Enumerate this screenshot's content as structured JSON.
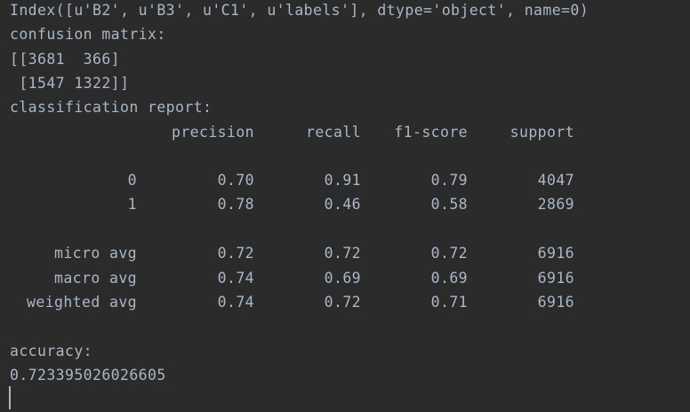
{
  "console": {
    "index_line": "Index([u'B2', u'B3', u'C1', u'labels'], dtype='object', name=0)",
    "confusion_label": "confusion matrix:",
    "matrix_row_1": "[[3681  366]",
    "matrix_row_2": " [1547 1322]]",
    "report_label": "classification report:",
    "report": {
      "headers": [
        "precision",
        "recall",
        "f1-score",
        "support"
      ],
      "rows": [
        {
          "label": "0",
          "precision": "0.70",
          "recall": "0.91",
          "f1": "0.79",
          "support": "4047"
        },
        {
          "label": "1",
          "precision": "0.78",
          "recall": "0.46",
          "f1": "0.58",
          "support": "2869"
        },
        {
          "label": "micro avg",
          "precision": "0.72",
          "recall": "0.72",
          "f1": "0.72",
          "support": "6916"
        },
        {
          "label": "macro avg",
          "precision": "0.74",
          "recall": "0.69",
          "f1": "0.69",
          "support": "6916"
        },
        {
          "label": "weighted avg",
          "precision": "0.74",
          "recall": "0.72",
          "f1": "0.71",
          "support": "6916"
        }
      ]
    },
    "accuracy_label": "accuracy:",
    "accuracy_value": "0.723395026026605"
  },
  "colors": {
    "background": "#2b2b2b",
    "text": "#a9b7c6"
  }
}
